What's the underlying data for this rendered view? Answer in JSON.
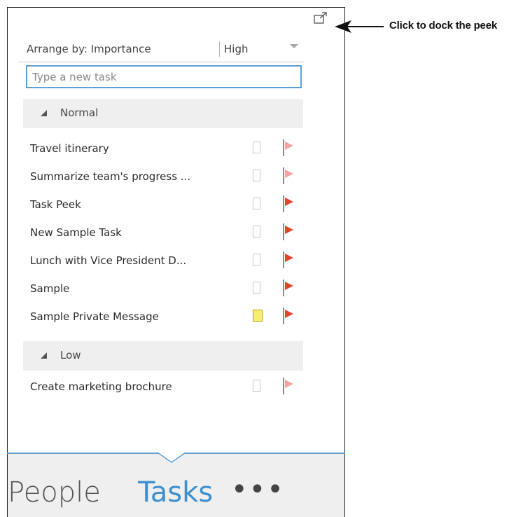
{
  "panel": {
    "dock_icon": "popout-icon",
    "arrange_label": "Arrange by: Importance",
    "sort_label": "High",
    "new_task_placeholder": "Type a new task"
  },
  "groups": [
    {
      "label": "Normal",
      "tasks": [
        {
          "title": "Travel itinerary",
          "flag": "light"
        },
        {
          "title": "Summarize team's progress ...",
          "flag": "light"
        },
        {
          "title": "Task Peek",
          "flag": "dark"
        },
        {
          "title": "New Sample Task",
          "flag": "dark"
        },
        {
          "title": "Lunch with Vice President D...",
          "flag": "dark"
        },
        {
          "title": "Sample",
          "flag": "dark"
        },
        {
          "title": "Sample Private Message",
          "flag": "dark",
          "category": "yellow"
        }
      ]
    },
    {
      "label": "Low",
      "tasks": [
        {
          "title": "Create marketing brochure",
          "flag": "light"
        }
      ]
    }
  ],
  "nav": {
    "people_label": "People",
    "tasks_label": "Tasks",
    "more_label": "•••"
  },
  "annotation": {
    "text": "Click to dock the peek"
  },
  "colors": {
    "accent": "#3d8fd0",
    "flag_dark": "#e2442b",
    "flag_light": "#f4a4a0",
    "category_yellow": "#f7ed72"
  }
}
